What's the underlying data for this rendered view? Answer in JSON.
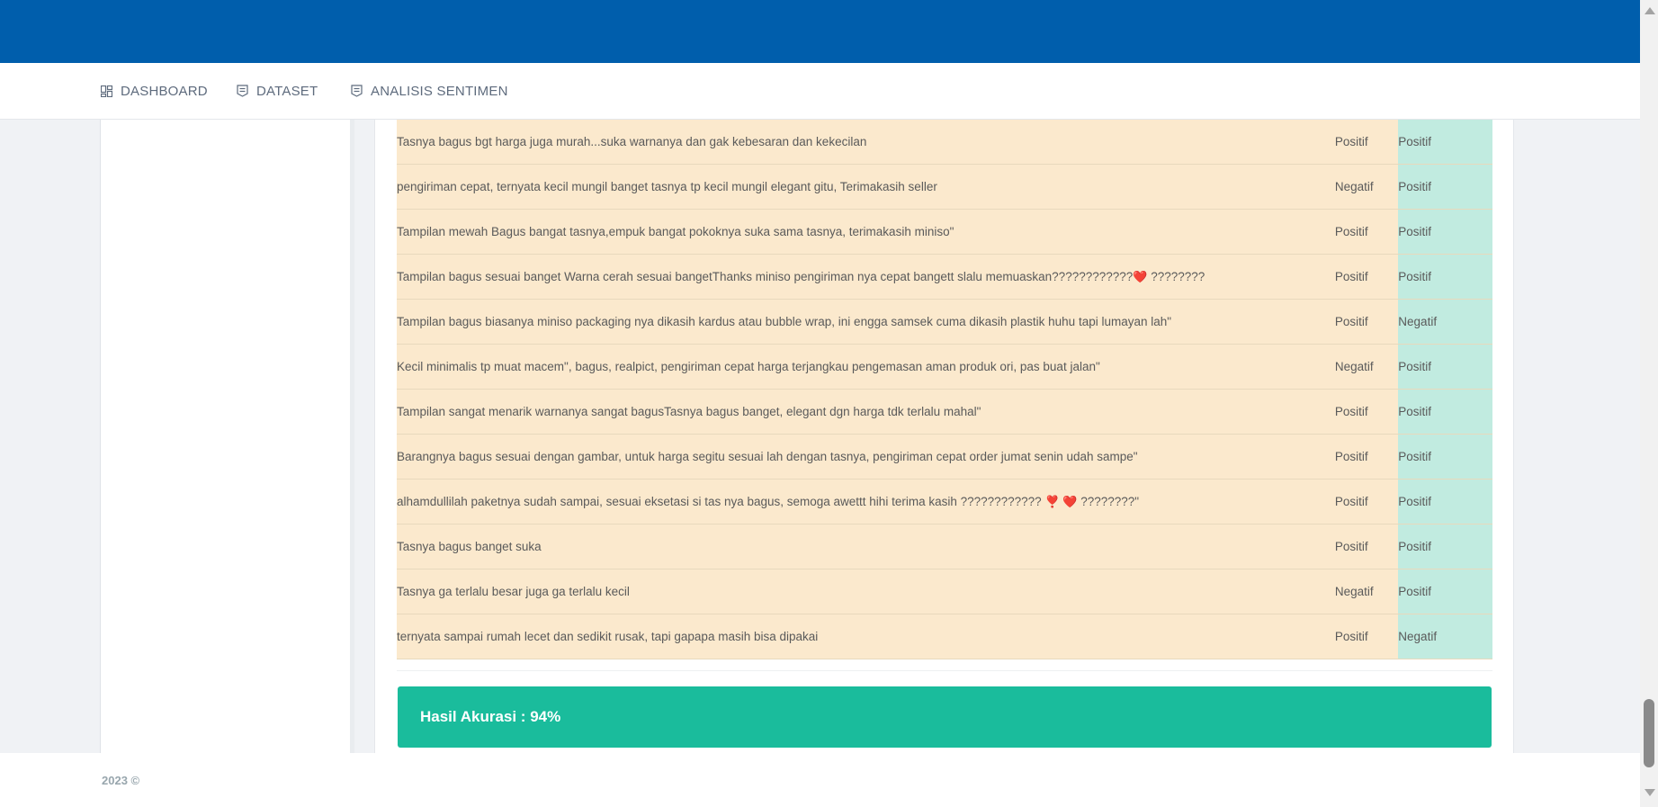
{
  "nav": {
    "items": [
      {
        "label": "DASHBOARD",
        "icon": "dashboard-icon"
      },
      {
        "label": "DATASET",
        "icon": "document-icon"
      },
      {
        "label": "ANALISIS SENTIMEN",
        "icon": "document-icon"
      }
    ]
  },
  "colors": {
    "header": "#005eac",
    "review_cell": "#fbe9cd",
    "prediction_cell": "#c1ebe0",
    "accuracy_banner": "#1abc9c"
  },
  "reviews": [
    {
      "text": "Tasnya bagus bgt harga juga murah...suka warnanya dan gak kebesaran dan kekecilan",
      "actual": "Positif",
      "predicted": "Positif"
    },
    {
      "text": "pengiriman cepat, ternyata kecil mungil banget tasnya tp kecil mungil elegant gitu, Terimakasih seller",
      "actual": "Negatif",
      "predicted": "Positif"
    },
    {
      "text": "Tampilan mewah Bagus bangat tasnya,empuk bangat pokoknya suka sama tasnya, terimakasih miniso\"",
      "actual": "Positif",
      "predicted": "Positif"
    },
    {
      "text": "Tampilan bagus sesuai banget Warna cerah sesuai bangetThanks miniso pengiriman nya cepat bangett slalu memuaskan????????????",
      "text_suffix": "????????",
      "emoji": "❤️",
      "actual": "Positif",
      "predicted": "Positif"
    },
    {
      "text": "Tampilan bagus biasanya miniso packaging nya dikasih kardus atau bubble wrap, ini engga samsek cuma dikasih plastik huhu tapi lumayan lah\"",
      "actual": "Positif",
      "predicted": "Negatif"
    },
    {
      "text": "Kecil minimalis tp muat macem\", bagus, realpict, pengiriman cepat harga terjangkau pengemasan aman produk ori, pas buat jalan\"",
      "actual": "Negatif",
      "predicted": "Positif"
    },
    {
      "text": "Tampilan sangat menarik warnanya sangat bagusTasnya bagus banget, elegant dgn harga tdk terlalu mahal\"",
      "actual": "Positif",
      "predicted": "Positif"
    },
    {
      "text": "Barangnya bagus sesuai dengan gambar, untuk harga segitu sesuai lah dengan tasnya, pengiriman cepat order jumat senin udah sampe\"",
      "actual": "Positif",
      "predicted": "Positif"
    },
    {
      "text": "alhamdullilah paketnya sudah sampai, sesuai eksetasi si tas nya bagus, semoga awettt hihi terima kasih ????????????",
      "text_suffix": "????????\"",
      "emoji": "❣️ ❤️",
      "actual": "Positif",
      "predicted": "Positif"
    },
    {
      "text": "Tasnya bagus banget suka",
      "actual": "Positif",
      "predicted": "Positif"
    },
    {
      "text": "Tasnya ga terlalu besar juga ga terlalu kecil",
      "actual": "Negatif",
      "predicted": "Positif"
    },
    {
      "text": "ternyata sampai rumah lecet dan sedikit rusak, tapi gapapa masih bisa dipakai",
      "actual": "Positif",
      "predicted": "Negatif"
    }
  ],
  "accuracy": {
    "label": "Hasil Akurasi : 94%"
  },
  "footer": {
    "text": "2023 ©"
  }
}
